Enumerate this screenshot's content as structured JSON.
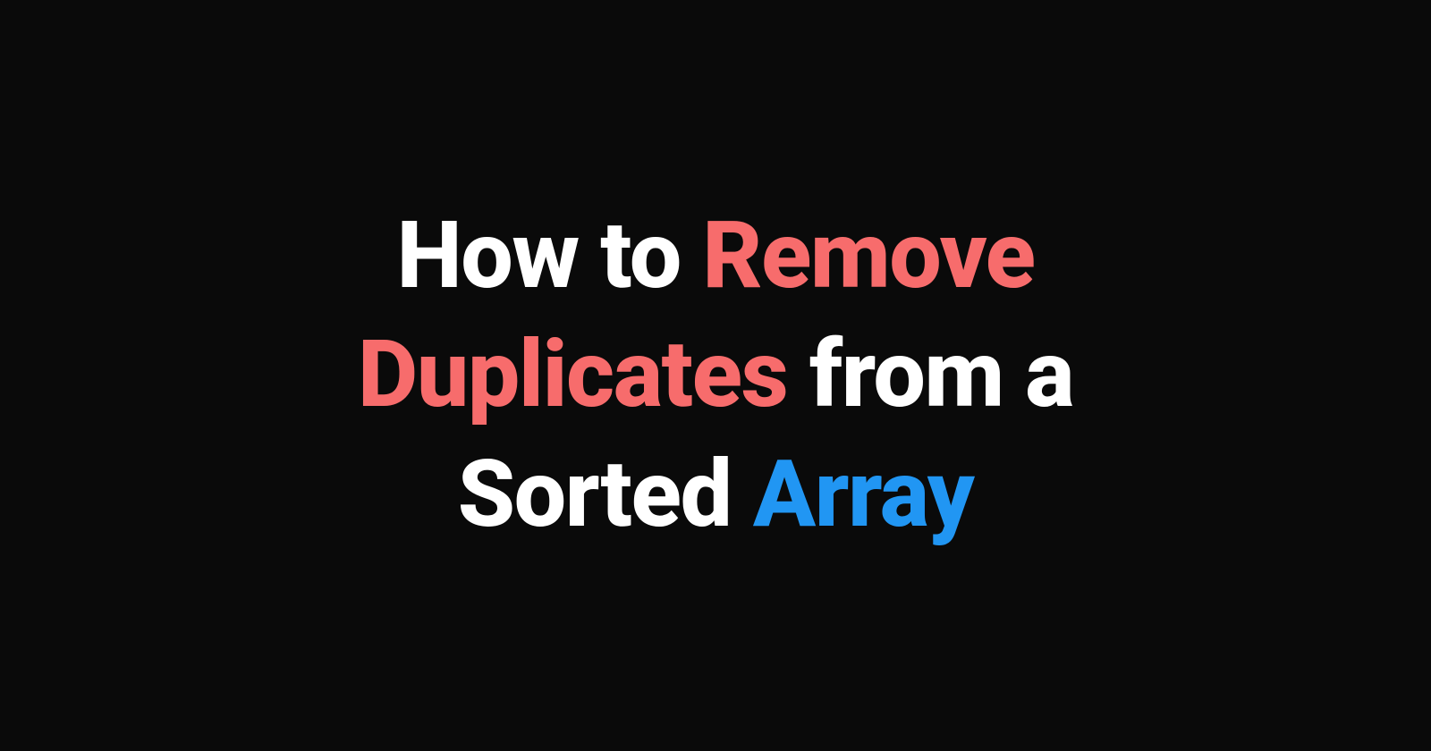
{
  "title": {
    "segments": [
      {
        "text": "How to ",
        "color": "white"
      },
      {
        "text": "Remove Duplicates",
        "color": "red"
      },
      {
        "text": " from a Sorted ",
        "color": "white"
      },
      {
        "text": "Array",
        "color": "blue"
      }
    ]
  },
  "colors": {
    "background": "#0a0a0a",
    "white": "#ffffff",
    "red": "#f76c6c",
    "blue": "#2196f3"
  }
}
